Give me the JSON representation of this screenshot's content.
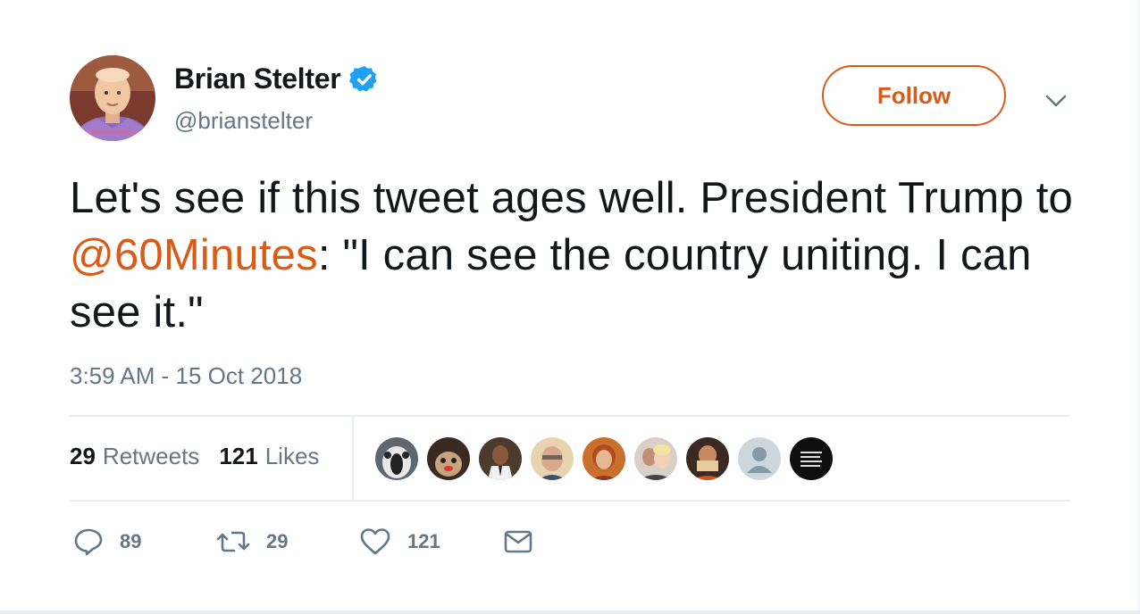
{
  "user": {
    "display_name": "Brian Stelter",
    "handle": "@brianstelter",
    "verified_icon": "verified-badge-icon"
  },
  "follow_button": {
    "label": "Follow"
  },
  "tweet": {
    "text_before": "Let's see if this tweet ages well. President Trump to ",
    "mention": "@60Minutes",
    "text_after": ": \"I can see the country uniting. I can see it.\"",
    "timestamp": "3:59 AM - 15 Oct 2018"
  },
  "stats": {
    "retweets_count": "29",
    "retweets_label": "Retweets",
    "likes_count": "121",
    "likes_label": "Likes"
  },
  "likers_count": 9,
  "actions": {
    "reply_count": "89",
    "retweet_count": "29",
    "like_count": "121"
  },
  "colors": {
    "accent": "#d95b17",
    "secondary_text": "#657786",
    "primary_text": "#14171a",
    "verified": "#1da1f2"
  }
}
